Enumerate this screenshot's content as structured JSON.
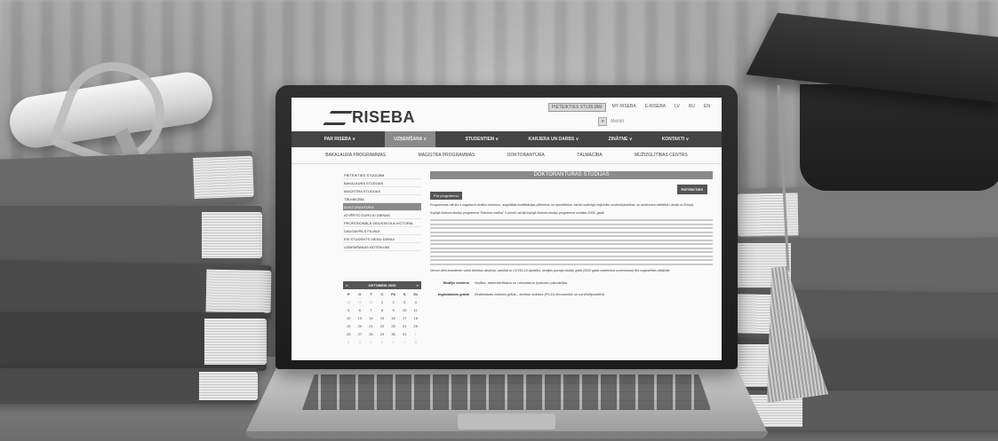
{
  "website": {
    "logo_text": "RISEBA",
    "top_links": [
      "PIETEIKTIES STUDIJĀM",
      "MY RISEBA",
      "E-RISEBA",
      "LV",
      "RU",
      "EN"
    ],
    "search_placeholder": "Meklēt",
    "main_nav": [
      "PAR RISEBA ∨",
      "UZŅEMŠANA ∨",
      "STUDENTIEM ∨",
      "KARJERA UN DARBS ∨",
      "ZINĀTNE ∨",
      "KONTAKTI ∨"
    ],
    "sub_nav": [
      "BAKALAURA PROGRAMMAS",
      "MAĢISTRA PROGRAMMAS",
      "DOKTORANTŪRA",
      "TĀLMĀCĪBA",
      "MŪŽIZGLĪTĪBAS CENTRS"
    ],
    "sidebar": [
      "PIETEIKTIES STUDIJĀM",
      "BAKALAURA STUDIJAS",
      "MAĢISTRA STUDIJAS",
      "TĀLMĀCĪBA",
      "DOKTORANTŪRA",
      "ATVĒRTO DURVJU DIENAS",
      "PROFESIONĀLĀ VIDUSSKOLA VICTORIA",
      "DAUGAVPILS FILIĀLE",
      "ESI STUDENTS VIENU DIENU!",
      "UZŅEMŠANAS NOTEIKUMI"
    ],
    "sidebar_active_index": 4,
    "calendar": {
      "month": "OKTOBRIS 2020",
      "prev": "<",
      "next": ">",
      "weekdays": [
        "P",
        "O",
        "T",
        "C",
        "Pk",
        "S",
        "Sv"
      ],
      "days": [
        "28",
        "29",
        "30",
        "1",
        "2",
        "3",
        "4",
        "5",
        "6",
        "7",
        "8",
        "9",
        "10",
        "11",
        "12",
        "13",
        "14",
        "15",
        "16",
        "17",
        "18",
        "19",
        "20",
        "21",
        "22",
        "23",
        "24",
        "25",
        "26",
        "27",
        "28",
        "29",
        "30",
        "31",
        "1",
        "2",
        "3",
        "4",
        "5",
        "6",
        "7",
        "8"
      ]
    },
    "page_title": "DOKTORANTŪRAS STUDIJAS",
    "apply_button": "PIETEIKTIES",
    "about_tab": "Par programmu",
    "intro_text": "Programmas mērķis ir sagatavot zinātņu doktorus, augstākās kvalifikācijas pētniekus un speciālistus, darbā nozīmīgo reģionālo uzņēmējdarbības un uzņēmumu attīstībā Latvijā un Eiropā.",
    "body_text": "Kopīgā doktora studiju programma \"Biznesa vadība\" ir pirmā Latvijā kopīgā doktora studiju programma uzsākta 2006. gadā.",
    "italic_note": "Ņemot vērā izstudiesto valsti ārkārtas situāciju, saistībā ar COVID-19 izplatību, studijas jaunaja studiju gadā (2020 gada septembra uzņemšana) tiks organizētas attālināti.",
    "info": [
      {
        "label": "Studiju virziens",
        "value": "Vadība, administrēšana un nekustamo īpašumu pārvaldība"
      },
      {
        "label": "Iegūstamais grāds",
        "value": "Zinātniskais doktora grāds - zinātņu doktors (Ph.D) ekonomikā un uzņēmējdarbībā"
      }
    ]
  }
}
